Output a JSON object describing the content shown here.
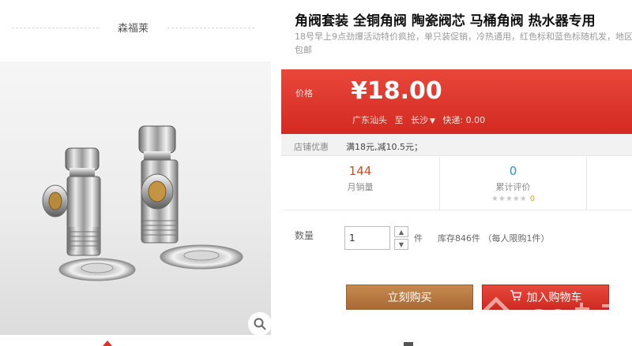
{
  "shop": {
    "name": "森福莱"
  },
  "product": {
    "title": "角阀套装 全铜角阀 陶瓷阀芯 马桶角阀 热水器专用",
    "subtitle": "18号早上9点劲爆活动特价疯抢，单只装促销，冷热通用，红色标和蓝色标随机发，地区包邮"
  },
  "price": {
    "label": "价格",
    "value": "¥18.00",
    "origin": "广东汕头",
    "to_label": "至",
    "destination": "长沙",
    "shipping": "快递: 0.00"
  },
  "promo": {
    "label": "店铺优惠",
    "text": "满18元,减10.5元；"
  },
  "stats": {
    "sales_count": "144",
    "sales_label": "月销量",
    "reviews_count": "0",
    "reviews_label": "累计评价",
    "stars": "★★★★★",
    "rating_value": "0"
  },
  "quantity": {
    "label": "数量",
    "value": "1",
    "unit": "件",
    "stock": "库存846件 （每人限购1件）"
  },
  "buttons": {
    "buy_now": "立刻购买",
    "add_to_cart": "加入购物车"
  },
  "icons": {
    "zoom": "magnifier-icon",
    "cart": "cart-icon",
    "caret": "chevron-down-icon"
  },
  "colors": {
    "price_bg": "#d9352c",
    "buy_button": "#b37440",
    "cart_button": "#d9352c",
    "sales_number": "#c84e28",
    "reviews_number": "#2d8fcf"
  }
}
